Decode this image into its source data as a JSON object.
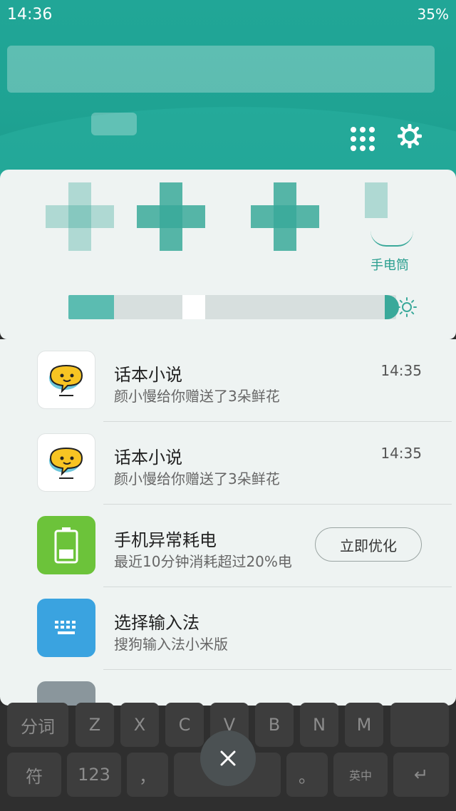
{
  "status_bar": {
    "time": "14:36",
    "battery": "35%"
  },
  "quick_settings": {
    "flashlight_label": "手电筒"
  },
  "notifications": [
    {
      "app_icon": "chat-bubble-face-icon",
      "title": "话本小说",
      "text": "颜小慢给你赠送了3朵鲜花",
      "time": "14:35"
    },
    {
      "app_icon": "chat-bubble-face-icon",
      "title": "话本小说",
      "text": "颜小慢给你赠送了3朵鲜花",
      "time": "14:35"
    },
    {
      "app_icon": "battery-icon",
      "title": "手机异常耗电",
      "text": "最近10分钟消耗超过20%电",
      "action_label": "立即优化"
    },
    {
      "app_icon": "keyboard-icon",
      "title": "选择输入法",
      "text": "搜狗输入法小米版"
    }
  ],
  "keyboard": {
    "row1": [
      "分词",
      "Z",
      "X",
      "C",
      "V",
      "B",
      "N",
      "M"
    ],
    "row2": [
      "符",
      "123",
      "，",
      "。",
      "英中"
    ]
  },
  "colors": {
    "accent": "#1fa393",
    "panel": "#eef3f2",
    "battery_green": "#6cc33a",
    "keyboard_blue": "#3aa3e0"
  }
}
